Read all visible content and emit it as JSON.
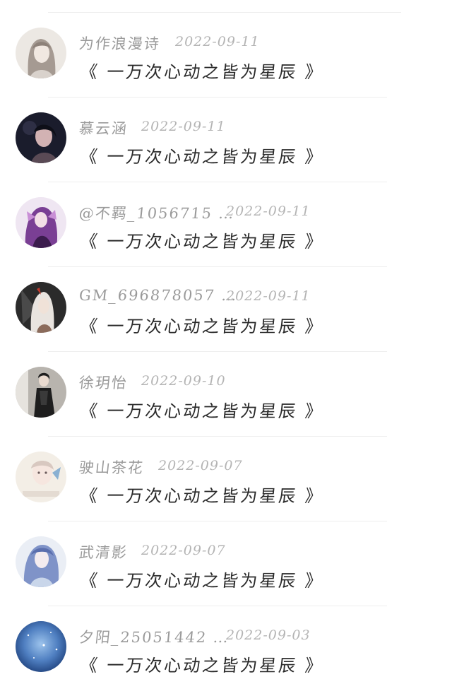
{
  "comments": [
    {
      "username": "为作浪漫诗",
      "date": "2022-09-11",
      "text": "《 一万次心动之皆为星辰 》",
      "avatar": "avatar-grey-hair-girl-icon",
      "colors": [
        "#d9d2cc",
        "#8d8179",
        "#f2eee9"
      ]
    },
    {
      "username": "慕云涵",
      "date": "2022-09-11",
      "text": "《 一万次心动之皆为星辰 》",
      "avatar": "avatar-dark-portrait-icon",
      "colors": [
        "#1a1c2c",
        "#5a4a55",
        "#c8a0a6"
      ]
    },
    {
      "username": "@不羁_1056715 …",
      "date": "2022-09-11",
      "text": "《 一万次心动之皆为星辰 》",
      "avatar": "avatar-purple-anime-icon",
      "colors": [
        "#7a3f94",
        "#c98fd6",
        "#3b1c4d"
      ]
    },
    {
      "username": "GM_696878057 …",
      "date": "2022-09-11",
      "text": "《 一万次心动之皆为星辰 》",
      "avatar": "avatar-white-hair-warrior-icon",
      "colors": [
        "#2b2b2b",
        "#e9e4df",
        "#8b6b5b"
      ]
    },
    {
      "username": "徐玥怡",
      "date": "2022-09-10",
      "text": "《 一万次心动之皆为星辰 》",
      "avatar": "avatar-black-outfit-girl-icon",
      "colors": [
        "#1e1e1e",
        "#b8b4ae",
        "#e6e3de"
      ]
    },
    {
      "username": "驶山茶花",
      "date": "2022-09-07",
      "text": "《 一万次心动之皆为星辰 》",
      "avatar": "avatar-pastel-sketch-icon",
      "colors": [
        "#f3eee6",
        "#d8c8c0",
        "#8ab0d2"
      ]
    },
    {
      "username": "武清影",
      "date": "2022-09-07",
      "text": "《 一万次心动之皆为星辰 》",
      "avatar": "avatar-blue-hair-anime-icon",
      "colors": [
        "#c9d6ea",
        "#7f93c8",
        "#eaeef5"
      ]
    },
    {
      "username": "夕阳_25051442 …",
      "date": "2022-09-03",
      "text": "《 一万次心动之皆为星辰 》",
      "avatar": "avatar-starry-sky-icon",
      "colors": [
        "#1d3f7a",
        "#4f7fc1",
        "#9cc3ec"
      ]
    }
  ]
}
